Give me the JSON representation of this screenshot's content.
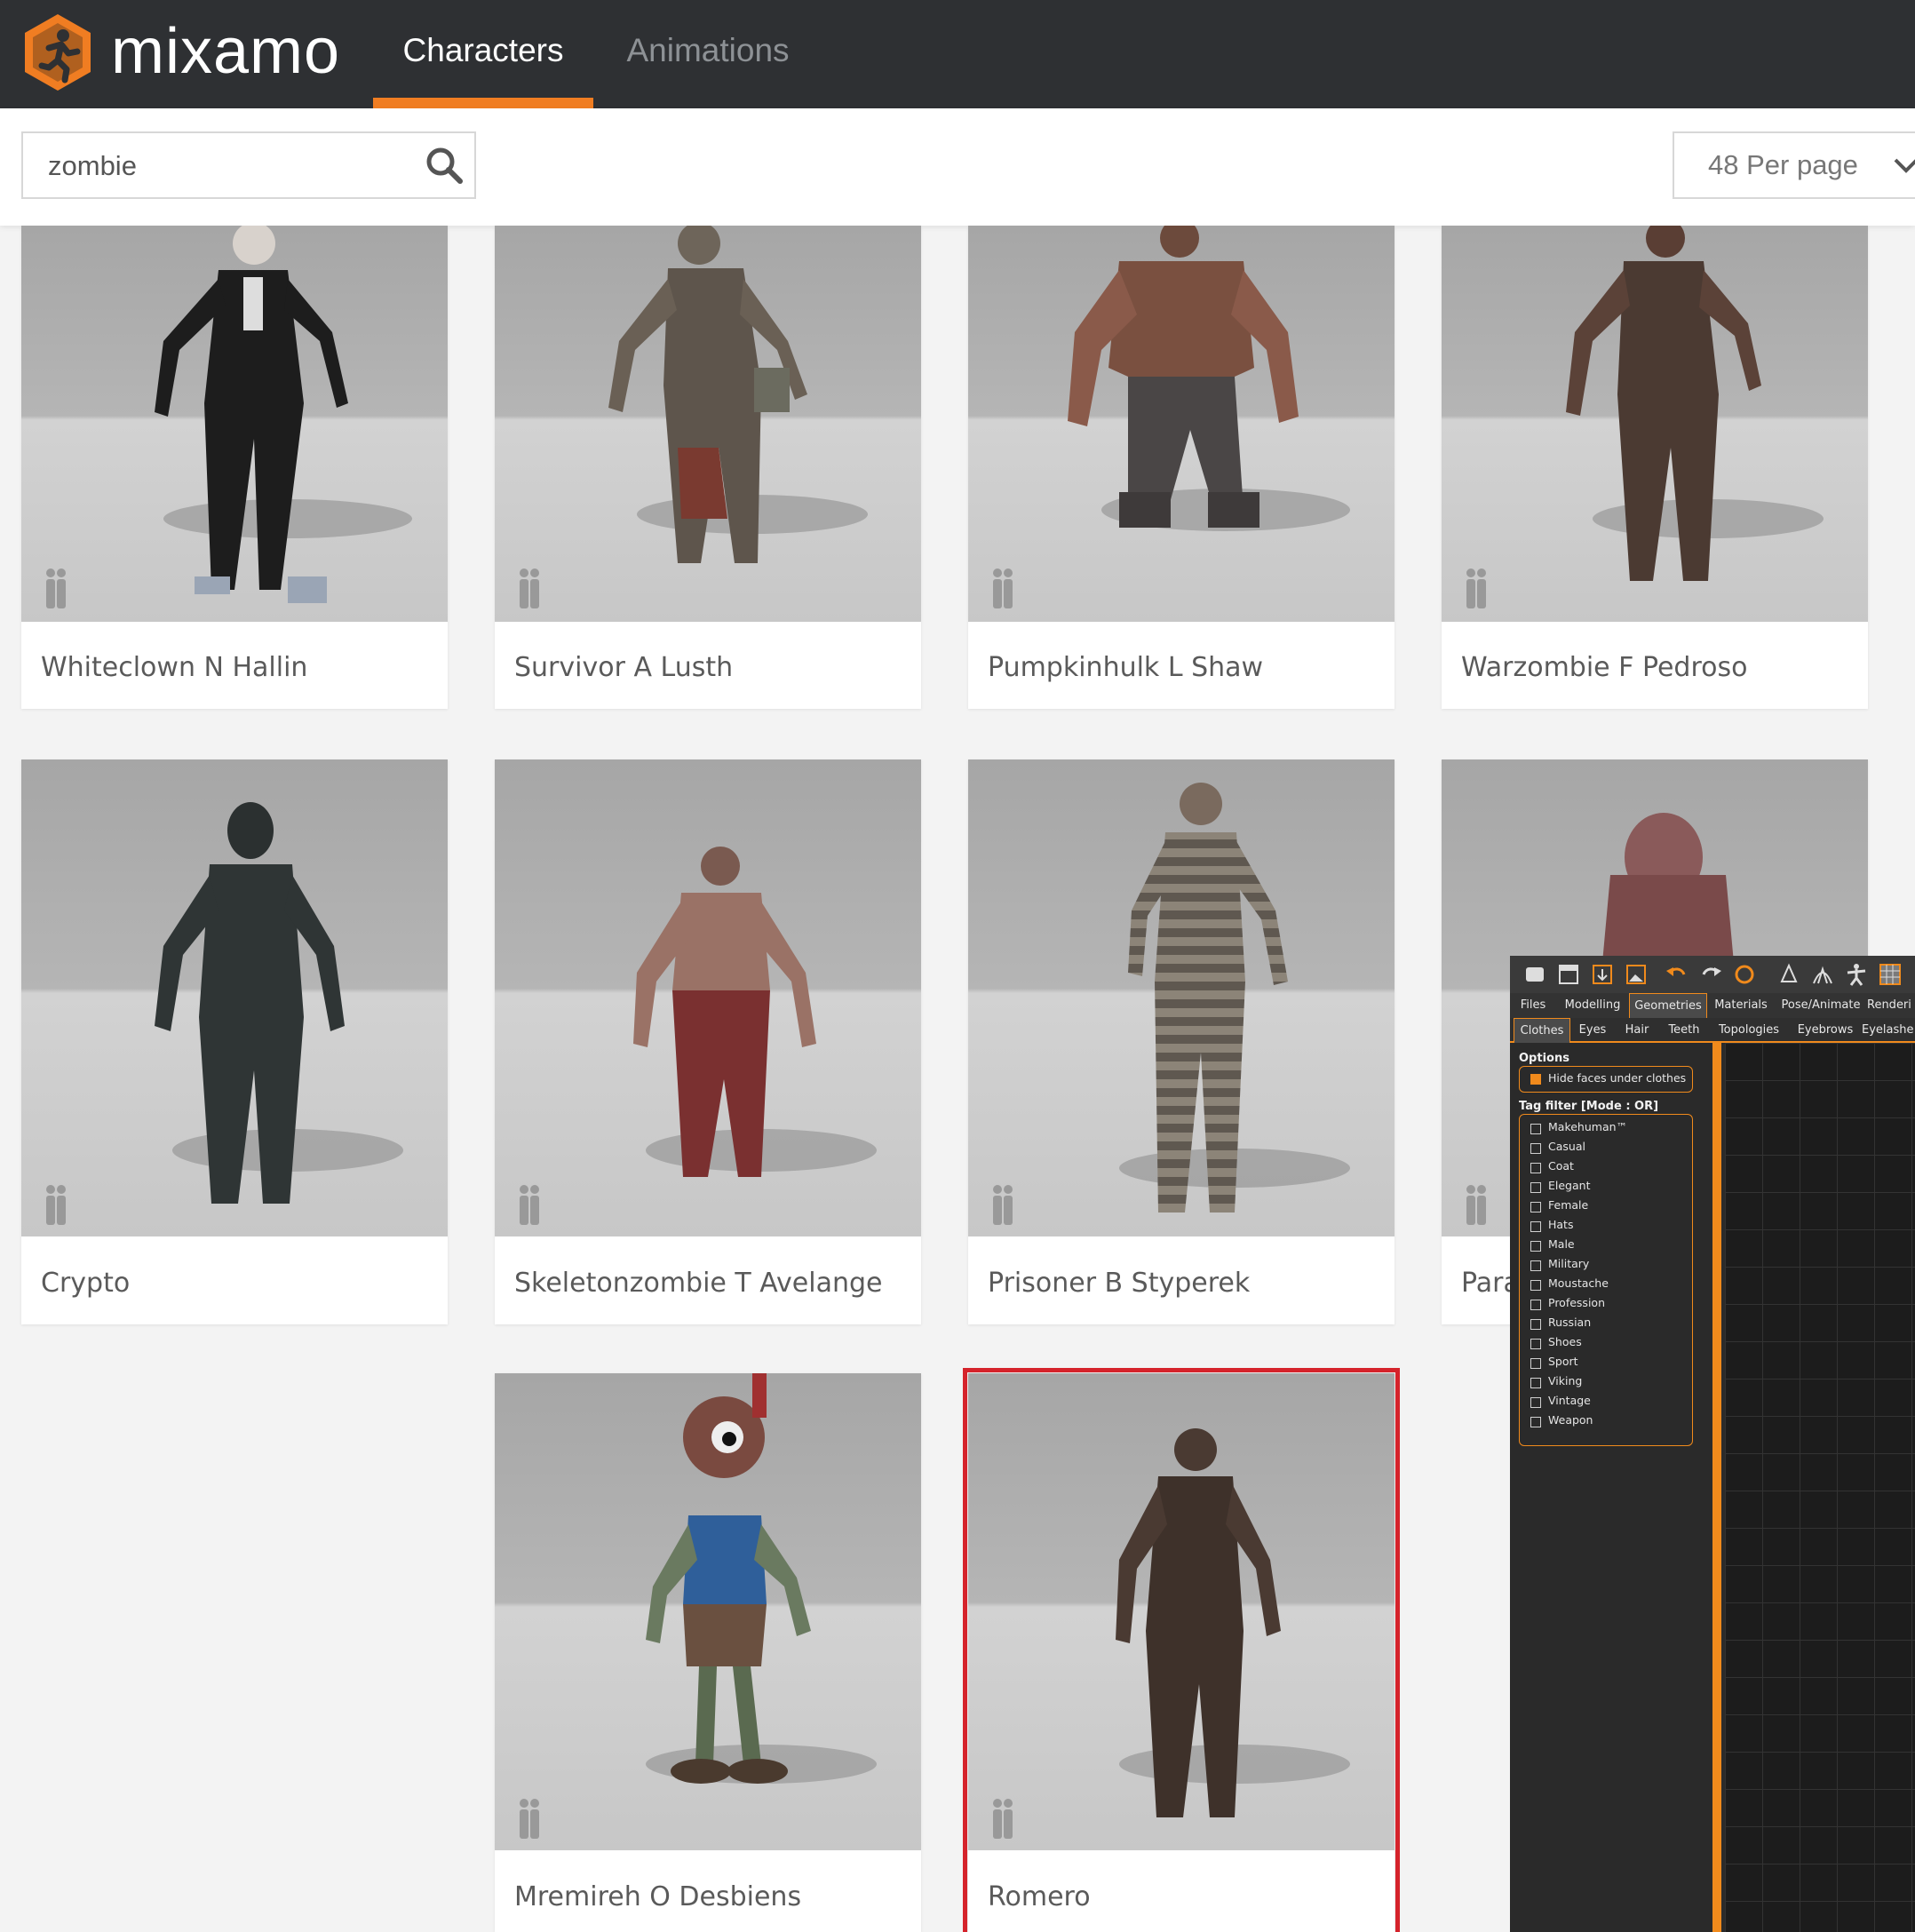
{
  "header": {
    "brand": "mixamo",
    "tabs": [
      {
        "label": "Characters",
        "active": true
      },
      {
        "label": "Animations",
        "active": false
      }
    ],
    "accent_color": "#f07d22"
  },
  "toolbar": {
    "search_value": "zombie",
    "search_icon": "search-icon",
    "per_page_label": "48 Per page"
  },
  "characters": [
    {
      "name": "Whiteclown N Hallin"
    },
    {
      "name": "Survivor A Lusth"
    },
    {
      "name": "Pumpkinhulk L Shaw"
    },
    {
      "name": "Warzombie F Pedroso"
    },
    {
      "name": "Crypto"
    },
    {
      "name": "Skeletonzombie T Avelange"
    },
    {
      "name": "Prisoner B Styperek"
    },
    {
      "name": "Para"
    },
    {
      "name": "Mremireh O Desbiens"
    },
    {
      "name": "Romero",
      "selected": true
    }
  ],
  "selection_color": "#d5232b",
  "makehuman": {
    "tabs_main": [
      "Files",
      "Modelling",
      "Geometries",
      "Materials",
      "Pose/Animate",
      "Renderi"
    ],
    "tabs_sub": [
      "Clothes",
      "Eyes",
      "Hair",
      "Teeth",
      "Topologies",
      "Eyebrows",
      "Eyelashe"
    ],
    "options_title": "Options",
    "option_hide_faces": "Hide faces under clothes",
    "tag_filter_title": "Tag filter [Mode : OR]",
    "tags": [
      "Makehuman™",
      "Casual",
      "Coat",
      "Elegant",
      "Female",
      "Hats",
      "Male",
      "Military",
      "Moustache",
      "Profession",
      "Russian",
      "Shoes",
      "Sport",
      "Viking",
      "Vintage",
      "Weapon"
    ],
    "accent_color": "#f08a1c"
  }
}
